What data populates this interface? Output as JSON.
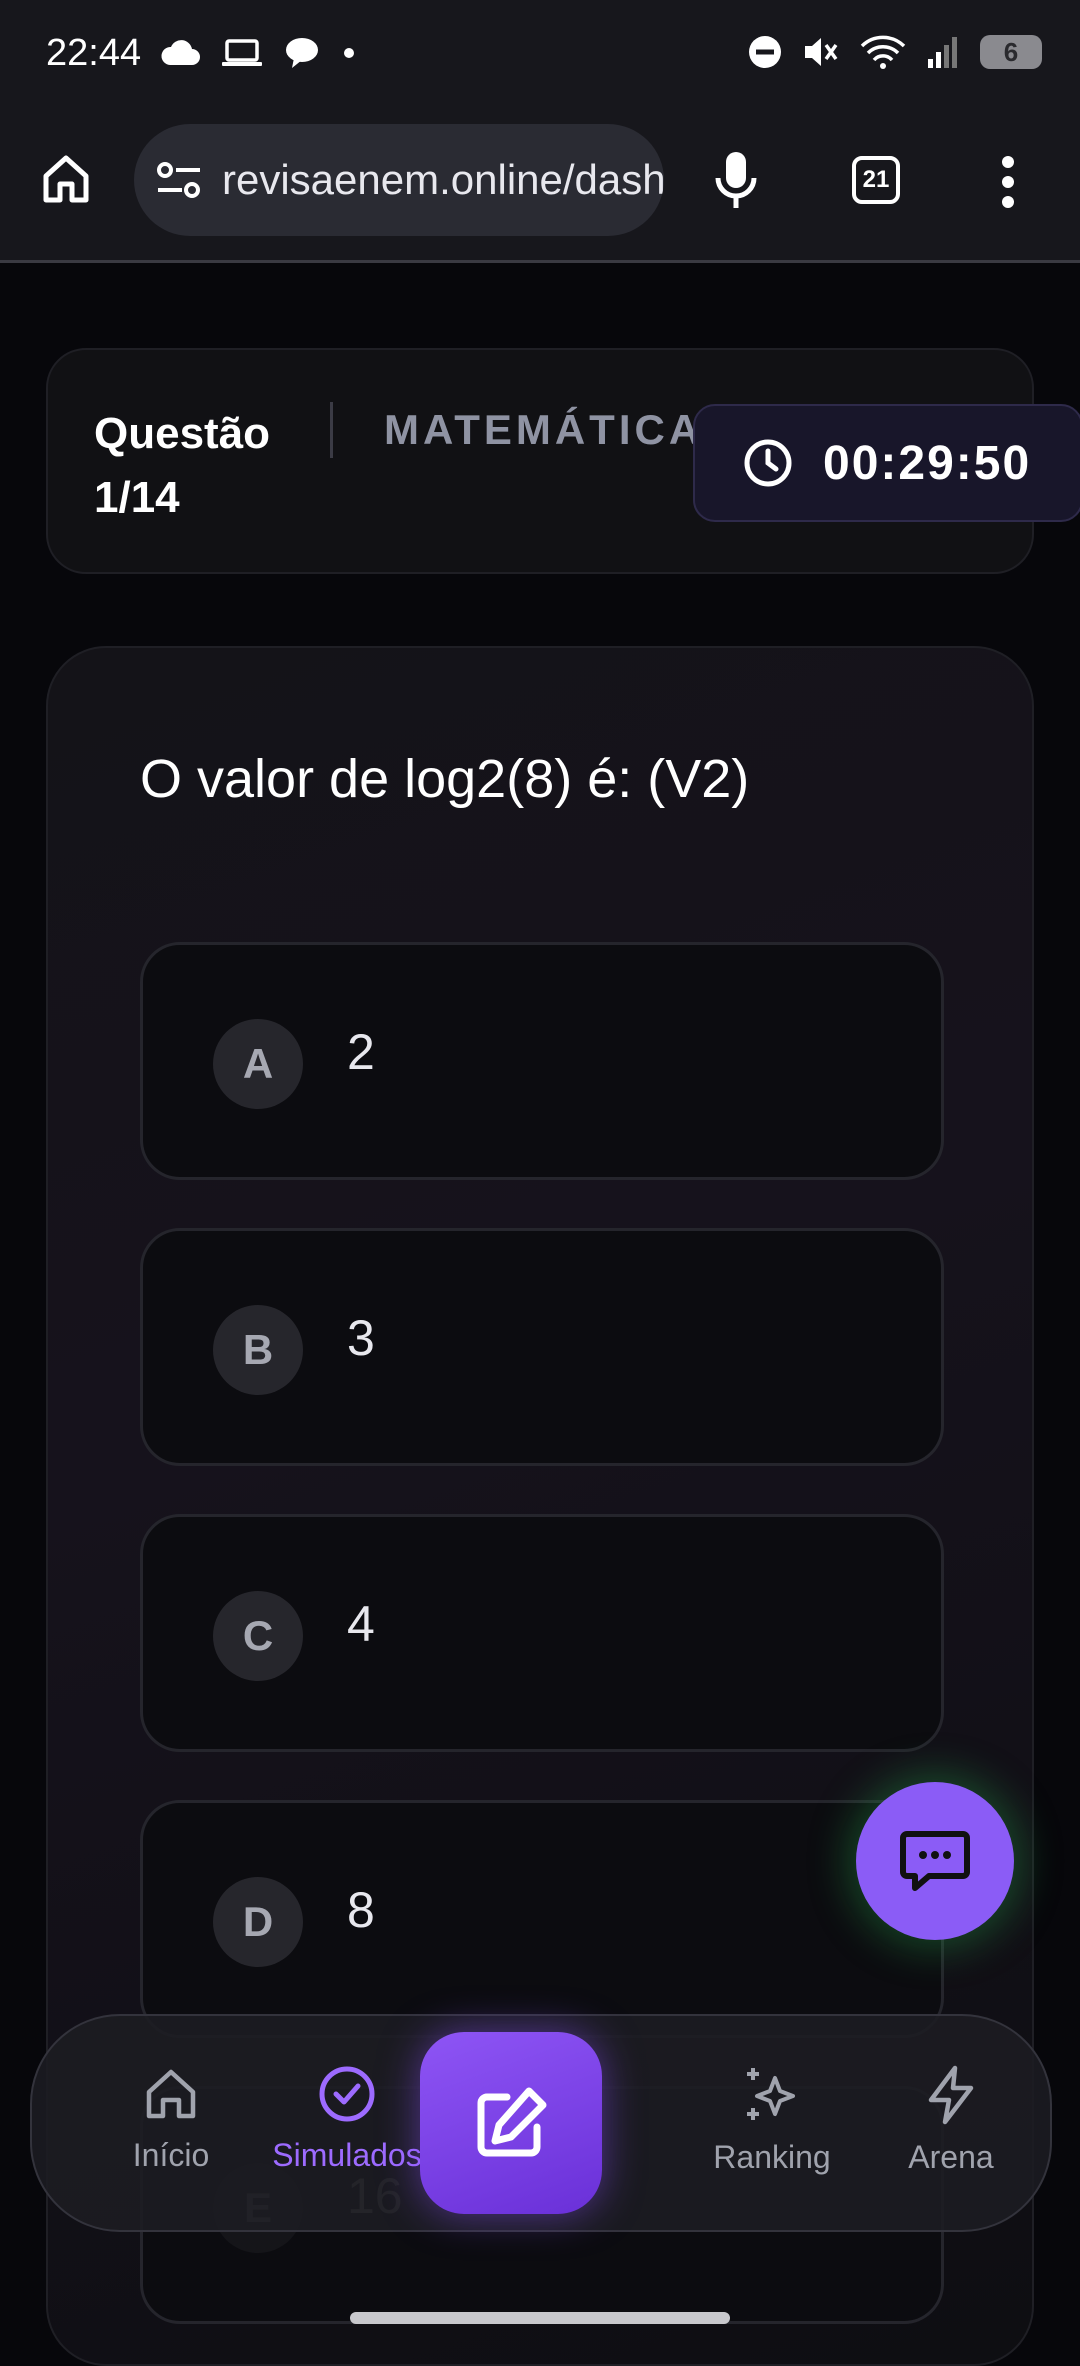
{
  "status_bar": {
    "time": "22:44",
    "left_icons": [
      "cloud-icon",
      "laptop-icon",
      "chat-bubble-icon",
      "dot-icon"
    ],
    "right_icons": [
      "dnd-icon",
      "mute-icon",
      "wifi-icon",
      "signal-icon"
    ],
    "battery": "6"
  },
  "browser": {
    "url": "revisaenem.online/dashboard",
    "tab_count": "21"
  },
  "header": {
    "question_label": "Questão",
    "question_progress": "1/14",
    "subject": "MATEMÁTICA",
    "timer": "00:29:50"
  },
  "question": {
    "text": "O valor de log2(8) é: (V2)",
    "options": [
      {
        "letter": "A",
        "text": "2"
      },
      {
        "letter": "B",
        "text": "3"
      },
      {
        "letter": "C",
        "text": "4"
      },
      {
        "letter": "D",
        "text": "8"
      },
      {
        "letter": "E",
        "text": "16"
      }
    ]
  },
  "bottom_nav": {
    "items": [
      {
        "label": "Início"
      },
      {
        "label": "Simulados"
      },
      {
        "label": "Ranking"
      },
      {
        "label": "Arena"
      }
    ],
    "active": "Simulados"
  },
  "colors": {
    "accent": "#8b5cf6",
    "active_nav": "#9d6bff",
    "background": "#07070b"
  }
}
